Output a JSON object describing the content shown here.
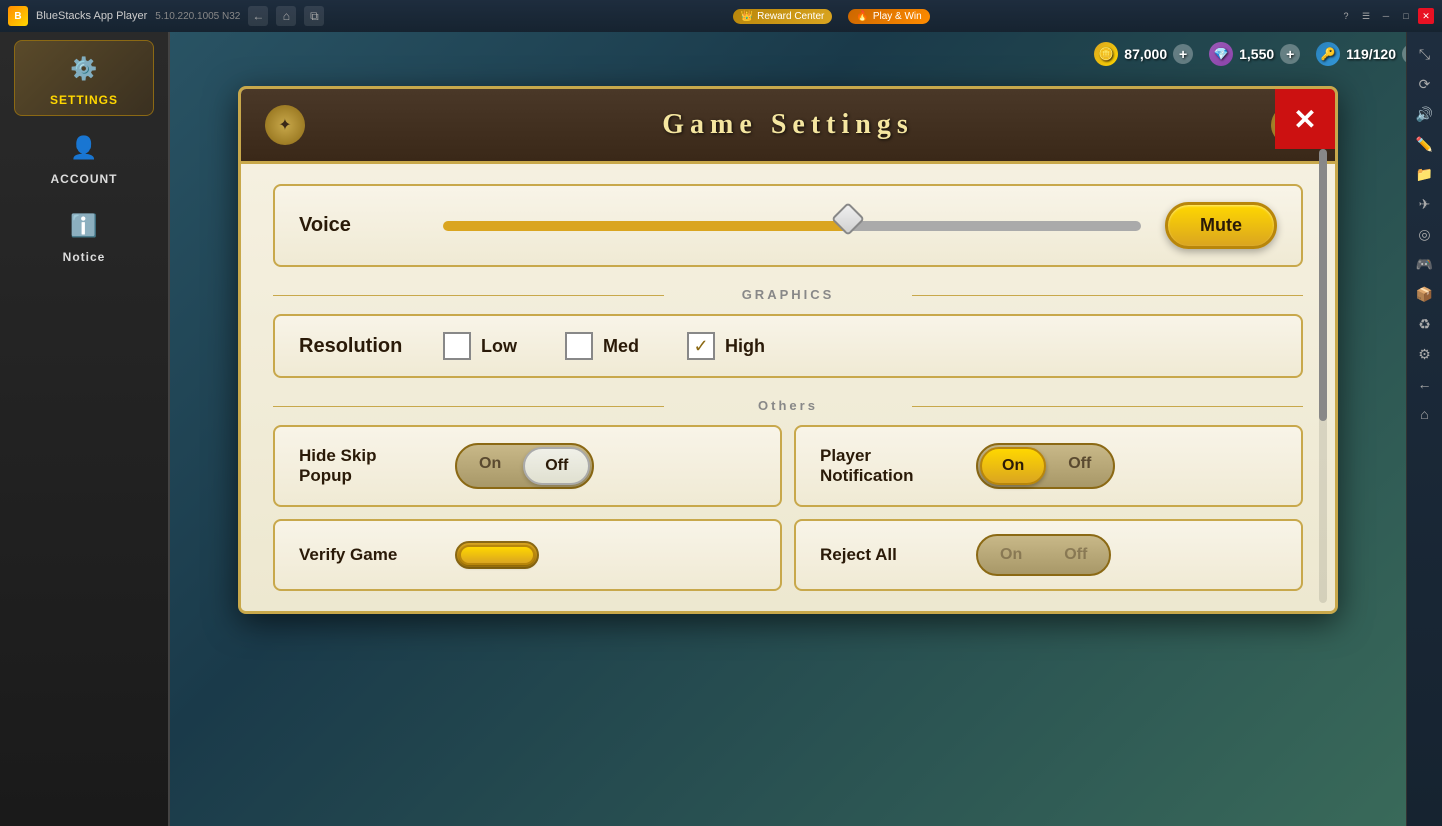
{
  "app": {
    "name": "BlueStacks App Player",
    "version": "5.10.220.1005  N32",
    "reward_center": "Reward Center",
    "play_and_win": "Play & Win"
  },
  "titlebar": {
    "back": "←",
    "home": "⌂",
    "copy": "⧉"
  },
  "hud": {
    "gold": "87,000",
    "gems": "1,550",
    "keys": "119/120"
  },
  "sidebar": {
    "settings_label": "SETTINGS",
    "account_label": "ACCOUNT",
    "notice_label": "Notice"
  },
  "modal": {
    "title": "Game  Settings",
    "close_btn": "✕",
    "voice_label": "Voice",
    "mute_label": "Mute",
    "graphics_label": "GRAPHICS",
    "resolution_label": "Resolution",
    "low_label": "Low",
    "med_label": "Med",
    "high_label": "High",
    "others_label": "Others",
    "hide_skip_label": "Hide Skip\nPopup",
    "player_notif_label": "Player\nNotification",
    "verify_game_label": "Verify Game",
    "reject_all_label": "Reject All",
    "on_label": "On",
    "off_label": "Off",
    "slider_value": 58
  },
  "right_toolbar": {
    "icons": [
      "⤡",
      "⟳",
      "☁",
      "✎",
      "✈",
      "◎",
      "☯",
      "⌘",
      "♻",
      "≡",
      "⚙",
      "←",
      "⌂"
    ]
  }
}
